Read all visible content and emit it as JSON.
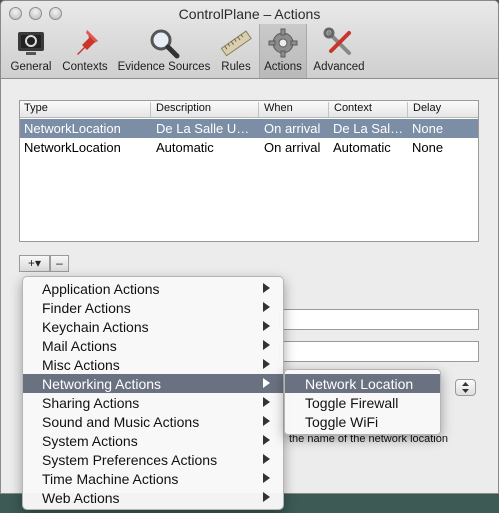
{
  "window": {
    "title": "ControlPlane – Actions"
  },
  "toolbar": {
    "items": [
      {
        "label": "General",
        "icon": "monitor-icon"
      },
      {
        "label": "Contexts",
        "icon": "pushpin-icon"
      },
      {
        "label": "Evidence Sources",
        "icon": "magnifier-icon"
      },
      {
        "label": "Rules",
        "icon": "ruler-icon"
      },
      {
        "label": "Actions",
        "icon": "gear-icon",
        "selected": true
      },
      {
        "label": "Advanced",
        "icon": "tools-icon"
      }
    ]
  },
  "table": {
    "columns": [
      "Type",
      "Description",
      "When",
      "Context",
      "Delay"
    ],
    "rows": [
      {
        "type": "NetworkLocation",
        "description": "De La Salle U…",
        "when": "On arrival",
        "context": "De La Sal…",
        "delay": "None",
        "selected": true
      },
      {
        "type": "NetworkLocation",
        "description": "Automatic",
        "when": "On arrival",
        "context": "Automatic",
        "delay": "None",
        "selected": false
      }
    ]
  },
  "buttons": {
    "add": "+▾",
    "remove": "–"
  },
  "detail": {
    "fine_print": "the name of the network location"
  },
  "menu": {
    "items": [
      "Application Actions",
      "Finder Actions",
      "Keychain Actions",
      "Mail Actions",
      "Misc Actions",
      "Networking Actions",
      "Sharing Actions",
      "Sound and Music Actions",
      "System Actions",
      "System Preferences Actions",
      "Time Machine Actions",
      "Web Actions"
    ],
    "highlighted": "Networking Actions"
  },
  "submenu": {
    "items": [
      "Network Location",
      "Toggle Firewall",
      "Toggle WiFi"
    ],
    "highlighted": "Network Location"
  },
  "colors": {
    "selection": "#7c8da6",
    "menu_highlight": "#6a7180",
    "desktop": "#3d5a55"
  }
}
